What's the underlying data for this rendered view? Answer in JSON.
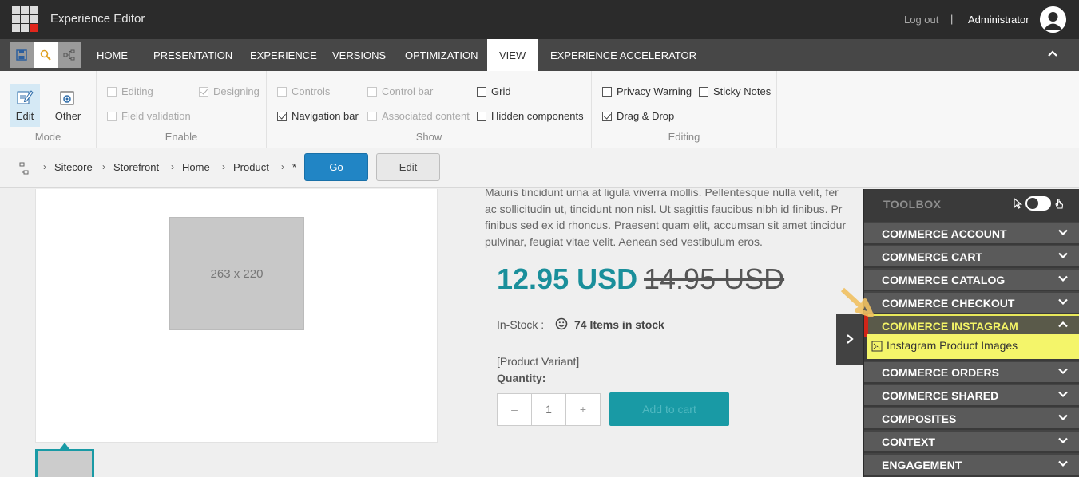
{
  "topbar": {
    "app_title": "Experience Editor",
    "logout": "Log out",
    "separator": "|",
    "user": "Administrator"
  },
  "tabs": [
    {
      "label": "HOME"
    },
    {
      "label": "PRESENTATION"
    },
    {
      "label": "EXPERIENCE"
    },
    {
      "label": "VERSIONS"
    },
    {
      "label": "OPTIMIZATION"
    },
    {
      "label": "VIEW",
      "active": true
    },
    {
      "label": "EXPERIENCE ACCELERATOR"
    }
  ],
  "ribbon": {
    "mode": {
      "label": "Mode",
      "edit": "Edit",
      "other": "Other"
    },
    "enable": {
      "label": "Enable",
      "editing": "Editing",
      "designing": "Designing",
      "field_validation": "Field validation"
    },
    "show": {
      "label": "Show",
      "controls": "Controls",
      "control_bar": "Control bar",
      "grid": "Grid",
      "navigation_bar": "Navigation bar",
      "associated_content": "Associated content",
      "hidden_components": "Hidden components"
    },
    "editing": {
      "label": "Editing",
      "privacy_warning": "Privacy Warning",
      "sticky_notes": "Sticky Notes",
      "drag_drop": "Drag & Drop"
    }
  },
  "breadcrumb": {
    "items": [
      "Sitecore",
      "Storefront",
      "Home",
      "Product",
      "*"
    ],
    "go": "Go",
    "edit": "Edit"
  },
  "product": {
    "image_placeholder": "263 x 220",
    "description_lines": [
      "Mauris tincidunt urna at ligula viverra mollis. Pellentesque nulla velit, fer",
      "ac sollicitudin ut, tincidunt non nisl. Ut sagittis faucibus nibh id finibus. Pr",
      "finibus sed ex id rhoncus. Praesent quam elit, accumsan sit amet tincidur",
      "pulvinar, feugiat vitae velit. Aenean sed vestibulum eros."
    ],
    "price": "12.95 USD",
    "old_price": "14.95 USD",
    "instock_label": "In-Stock :",
    "instock_count": "74 Items in stock",
    "variant": "[Product Variant]",
    "quantity_label": "Quantity:",
    "quantity_minus": "–",
    "quantity_value": "1",
    "quantity_plus": "+",
    "add_to_cart": "Add to cart"
  },
  "toolbox": {
    "title": "TOOLBOX",
    "sections": [
      "COMMERCE ACCOUNT",
      "COMMERCE CART",
      "COMMERCE CATALOG",
      "COMMERCE CHECKOUT",
      "COMMERCE INSTAGRAM",
      "COMMERCE ORDERS",
      "COMMERCE SHARED",
      "COMPOSITES",
      "CONTEXT",
      "ENGAGEMENT"
    ],
    "open_item": "Instagram Product Images"
  },
  "colors": {
    "accent": "#199aa5",
    "go_button": "#2185c5",
    "highlight": "#f4f56a"
  }
}
